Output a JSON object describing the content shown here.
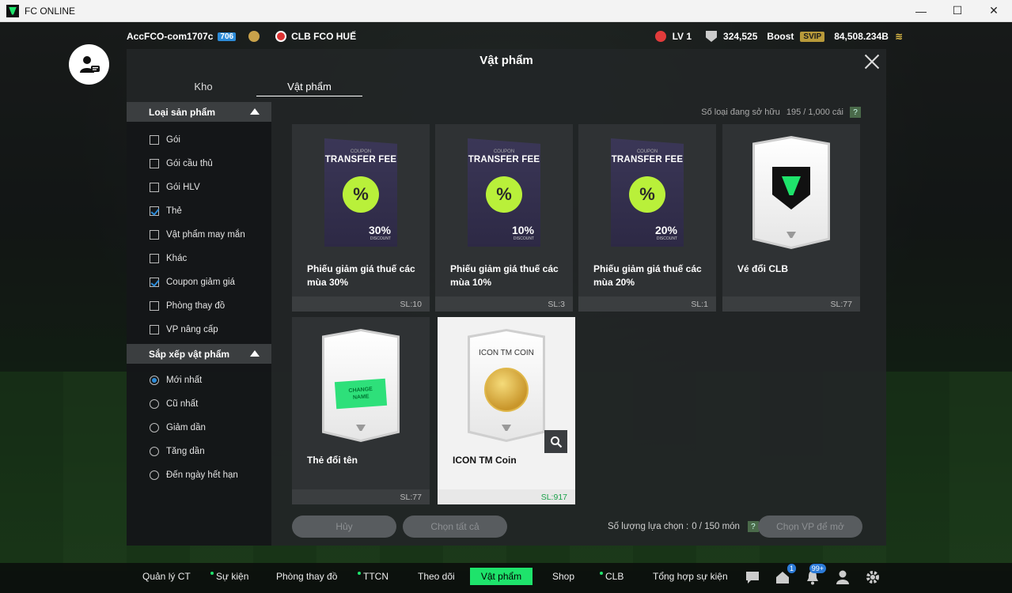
{
  "window": {
    "title": "FC ONLINE",
    "minimize": "—",
    "maximize": "☐",
    "close": "✕"
  },
  "hud": {
    "username": "AccFCO-com1707c",
    "ovr": "706",
    "club_name": "CLB FCO HUẾ",
    "level": "LV 1",
    "points": "324,525",
    "boost_label": "Boost",
    "vip_label": "SVIP",
    "currency": "84,508.234B"
  },
  "modal": {
    "title": "Vật phẩm",
    "tabs": [
      {
        "label": "Kho"
      },
      {
        "label": "Vật phẩm"
      }
    ],
    "owned_label": "Số loại đang sở hữu",
    "owned_value": "195 / 1,000 cái",
    "help": "?"
  },
  "sidebar": {
    "product_type_title": "Loại sản phẩm",
    "product_types": [
      {
        "label": "Gói",
        "checked": false
      },
      {
        "label": "Gói cầu thủ",
        "checked": false
      },
      {
        "label": "Gói HLV",
        "checked": false
      },
      {
        "label": "Thẻ",
        "checked": true
      },
      {
        "label": "Vật phẩm may mắn",
        "checked": false
      },
      {
        "label": "Khác",
        "checked": false
      },
      {
        "label": "Coupon giảm giá",
        "checked": true
      },
      {
        "label": "Phòng thay đồ",
        "checked": false
      },
      {
        "label": "VP nâng cấp",
        "checked": false
      }
    ],
    "sort_title": "Sắp xếp vật phẩm",
    "sort_options": [
      {
        "label": "Mới nhất",
        "selected": true
      },
      {
        "label": "Cũ nhất",
        "selected": false
      },
      {
        "label": "Giảm dần",
        "selected": false
      },
      {
        "label": "Tăng dần",
        "selected": false
      },
      {
        "label": "Đến ngày hết hạn",
        "selected": false
      }
    ]
  },
  "items": [
    {
      "name": "Phiếu giảm giá thuế các mùa 30%",
      "qty": "SL:10",
      "coupon_sub": "COUPON",
      "coupon_title": "TRANSFER FEE",
      "pct": "30%",
      "disc": "DISCOUNT",
      "seal": "%"
    },
    {
      "name": "Phiếu giảm giá thuế các mùa 10%",
      "qty": "SL:3",
      "coupon_sub": "COUPON",
      "coupon_title": "TRANSFER FEE",
      "pct": "10%",
      "disc": "DISCOUNT",
      "seal": "%"
    },
    {
      "name": "Phiếu giảm giá thuế các mùa 20%",
      "qty": "SL:1",
      "coupon_sub": "COUPON",
      "coupon_title": "TRANSFER FEE",
      "pct": "20%",
      "disc": "DISCOUNT",
      "seal": "%"
    },
    {
      "name": "Vé đổi CLB",
      "qty": "SL:77"
    },
    {
      "name": "Thẻ đổi tên",
      "qty": "SL:77",
      "tag_line1": "CHANGE",
      "tag_line2": "NAME"
    },
    {
      "name": "ICON TM Coin",
      "qty": "SL:917",
      "card_title": "ICON TM COIN"
    }
  ],
  "actions": {
    "cancel": "Hủy",
    "select_all": "Chọn tất cả",
    "selection_label": "Số lượng lựa chọn :",
    "selection_value": "0 / 150 món",
    "open": "Chọn VP để mở"
  },
  "nav": {
    "items": [
      "Quản lý CT",
      "Sự kiện",
      "Phòng thay đồ",
      "TTCN",
      "Theo dõi",
      "Vật phẩm",
      "Shop",
      "CLB",
      "Tổng hợp sự kiện"
    ],
    "home_badge": "1",
    "notif_badge": "99+"
  },
  "colors": {
    "accent": "#1ee36b",
    "check": "#2c8bd8",
    "modal": "#222526"
  }
}
